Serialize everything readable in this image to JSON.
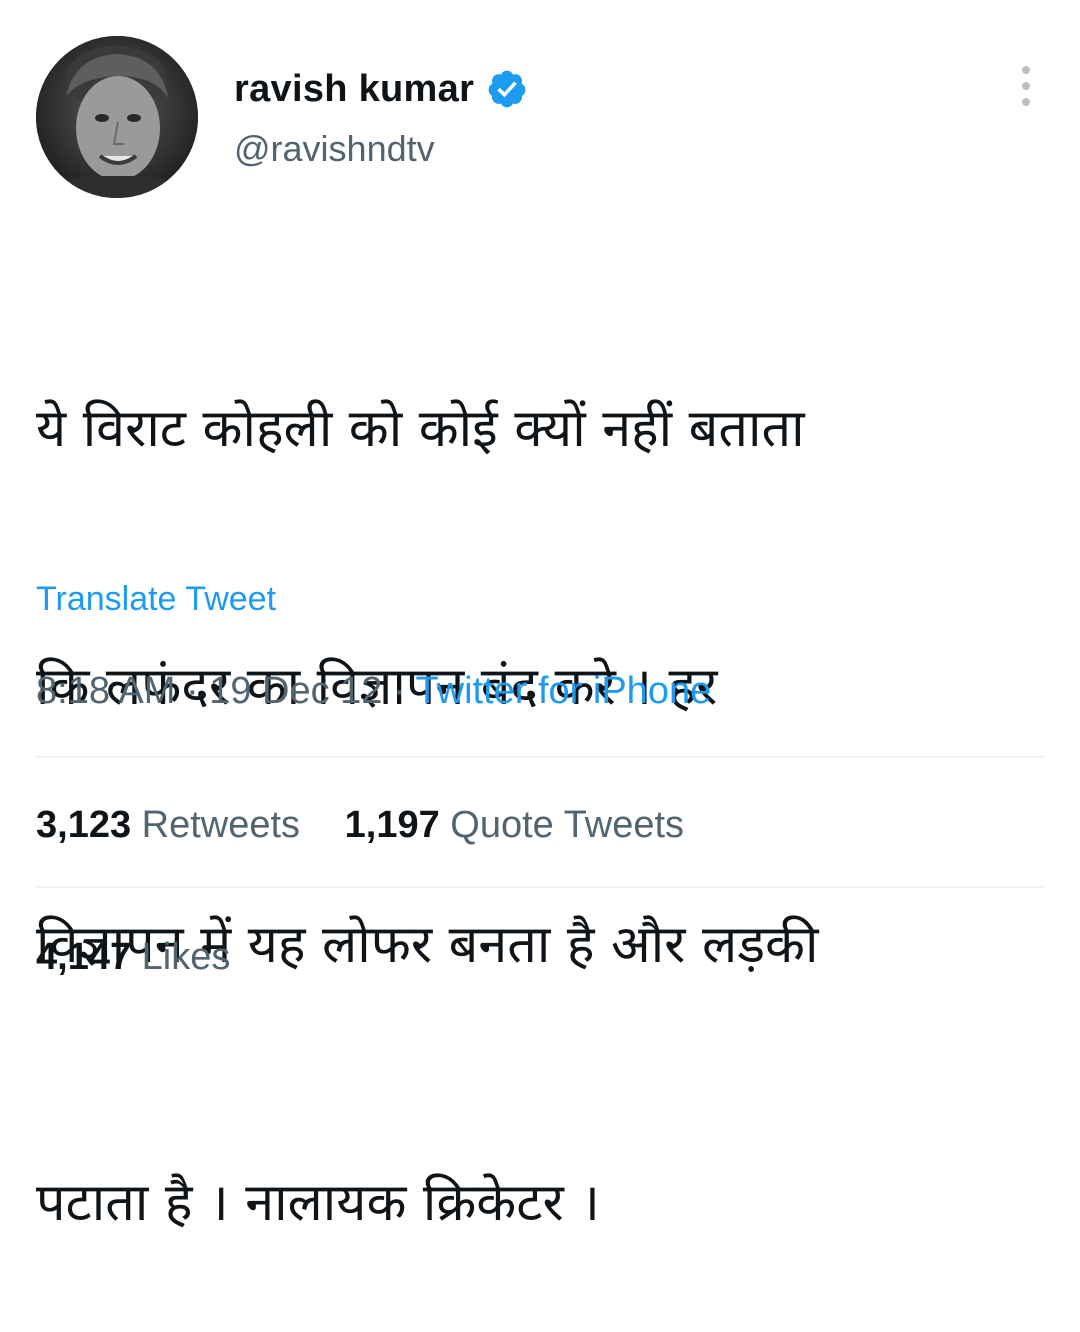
{
  "user": {
    "display_name": "ravish kumar",
    "handle": "@ravishndtv",
    "verified": true
  },
  "tweet": {
    "text_lines": [
      "ये विराट कोहली को कोई क्यों नहीं बताता",
      "कि लफंदर का विज्ञापन बंद करे । हर",
      "विज्ञापन में यह लोफर बनता है और लड़की",
      "पटाता है । नालायक क्रिकेटर ।"
    ],
    "translate_label": "Translate Tweet",
    "time": "8:18 AM",
    "separator": "·",
    "date": "19 Dec 12",
    "source": "Twitter for iPhone"
  },
  "stats": {
    "retweets_count": "3,123",
    "retweets_label": "Retweets",
    "quotes_count": "1,197",
    "quotes_label": "Quote Tweets",
    "likes_count": "4,147",
    "likes_label": "Likes"
  },
  "icons": {
    "verified": "verified-badge-icon",
    "more": "more-vertical-icon"
  },
  "colors": {
    "accent": "#1d9bf0",
    "text_primary": "#0f1419",
    "text_secondary": "#536471",
    "divider": "#eff3f4"
  }
}
